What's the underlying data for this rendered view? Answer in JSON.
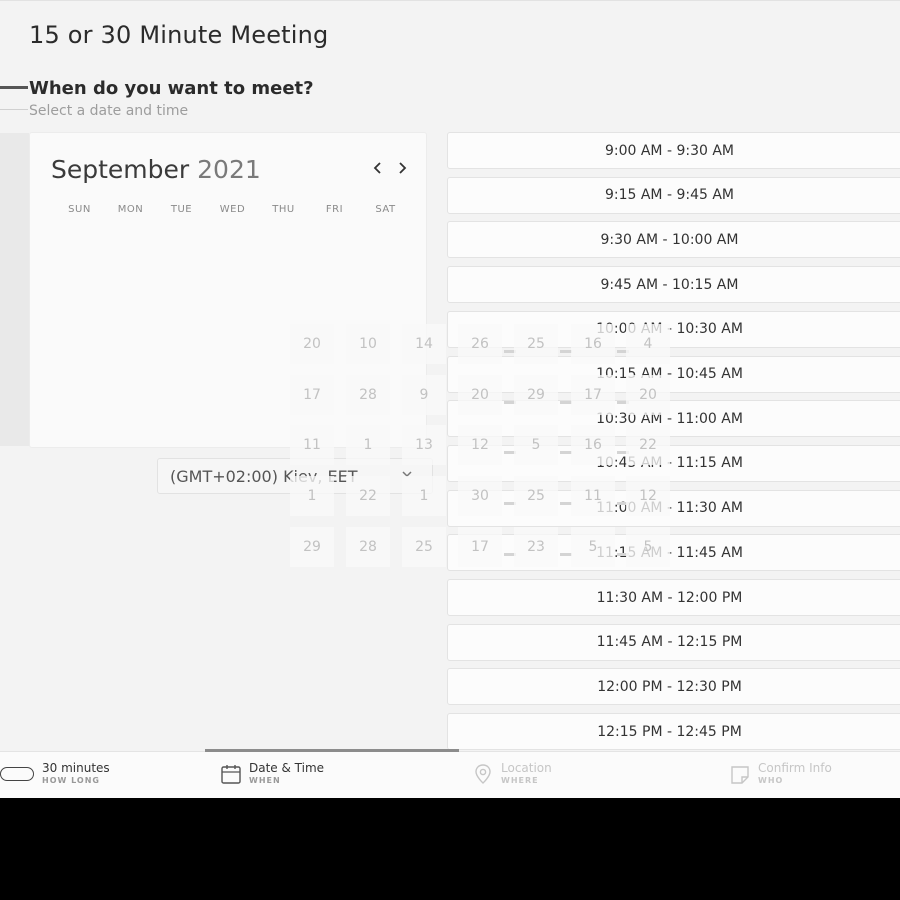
{
  "page": {
    "title": "15 or 30 Minute Meeting",
    "section_title": "When do you want to meet?",
    "section_subtitle": "Select a date and time"
  },
  "calendar": {
    "month": "September",
    "year": "2021",
    "prev_icon": "‹",
    "next_icon": "›",
    "weekdays": [
      "SUN",
      "MON",
      "TUE",
      "WED",
      "THU",
      "FRI",
      "SAT"
    ]
  },
  "timezone": {
    "value": "(GMT+02:00) Kiev, EET"
  },
  "time_slots": [
    "9:00 AM - 9:30 AM",
    "9:15 AM - 9:45 AM",
    "9:30 AM - 10:00 AM",
    "9:45 AM - 10:15 AM",
    "10:00 AM - 10:30 AM",
    "10:15 AM - 10:45 AM",
    "10:30 AM - 11:00 AM",
    "10:45 AM - 11:15 AM",
    "11:00 AM - 11:30 AM",
    "11:15 AM - 11:45 AM",
    "11:30 AM - 12:00 PM",
    "11:45 AM - 12:15 PM",
    "12:00 PM - 12:30 PM",
    "12:15 PM - 12:45 PM"
  ],
  "date_overlay": [
    [
      "20",
      "10",
      "14",
      "26",
      "25",
      "16",
      "4"
    ],
    [
      "17",
      "28",
      "9",
      "20",
      "29",
      "17",
      "20"
    ],
    [
      "11",
      "1",
      "13",
      "12",
      "5",
      "16",
      "22"
    ],
    [
      "1",
      "22",
      "1",
      "30",
      "25",
      "11",
      "12"
    ],
    [
      "29",
      "28",
      "25",
      "17",
      "23",
      "5",
      "5"
    ]
  ],
  "steps": [
    {
      "label": "30 minutes",
      "sub": "HOW LONG",
      "icon": "duration-pill-icon"
    },
    {
      "label": "Date & Time",
      "sub": "WHEN",
      "icon": "calendar-icon"
    },
    {
      "label": "Location",
      "sub": "WHERE",
      "icon": "location-pin-icon"
    },
    {
      "label": "Confirm Info",
      "sub": "WHO",
      "icon": "note-icon"
    }
  ],
  "colors": {
    "background": "#f3f3f3",
    "card": "#fafafa",
    "text": "#2b2b2b",
    "muted": "#9d9d9d"
  }
}
